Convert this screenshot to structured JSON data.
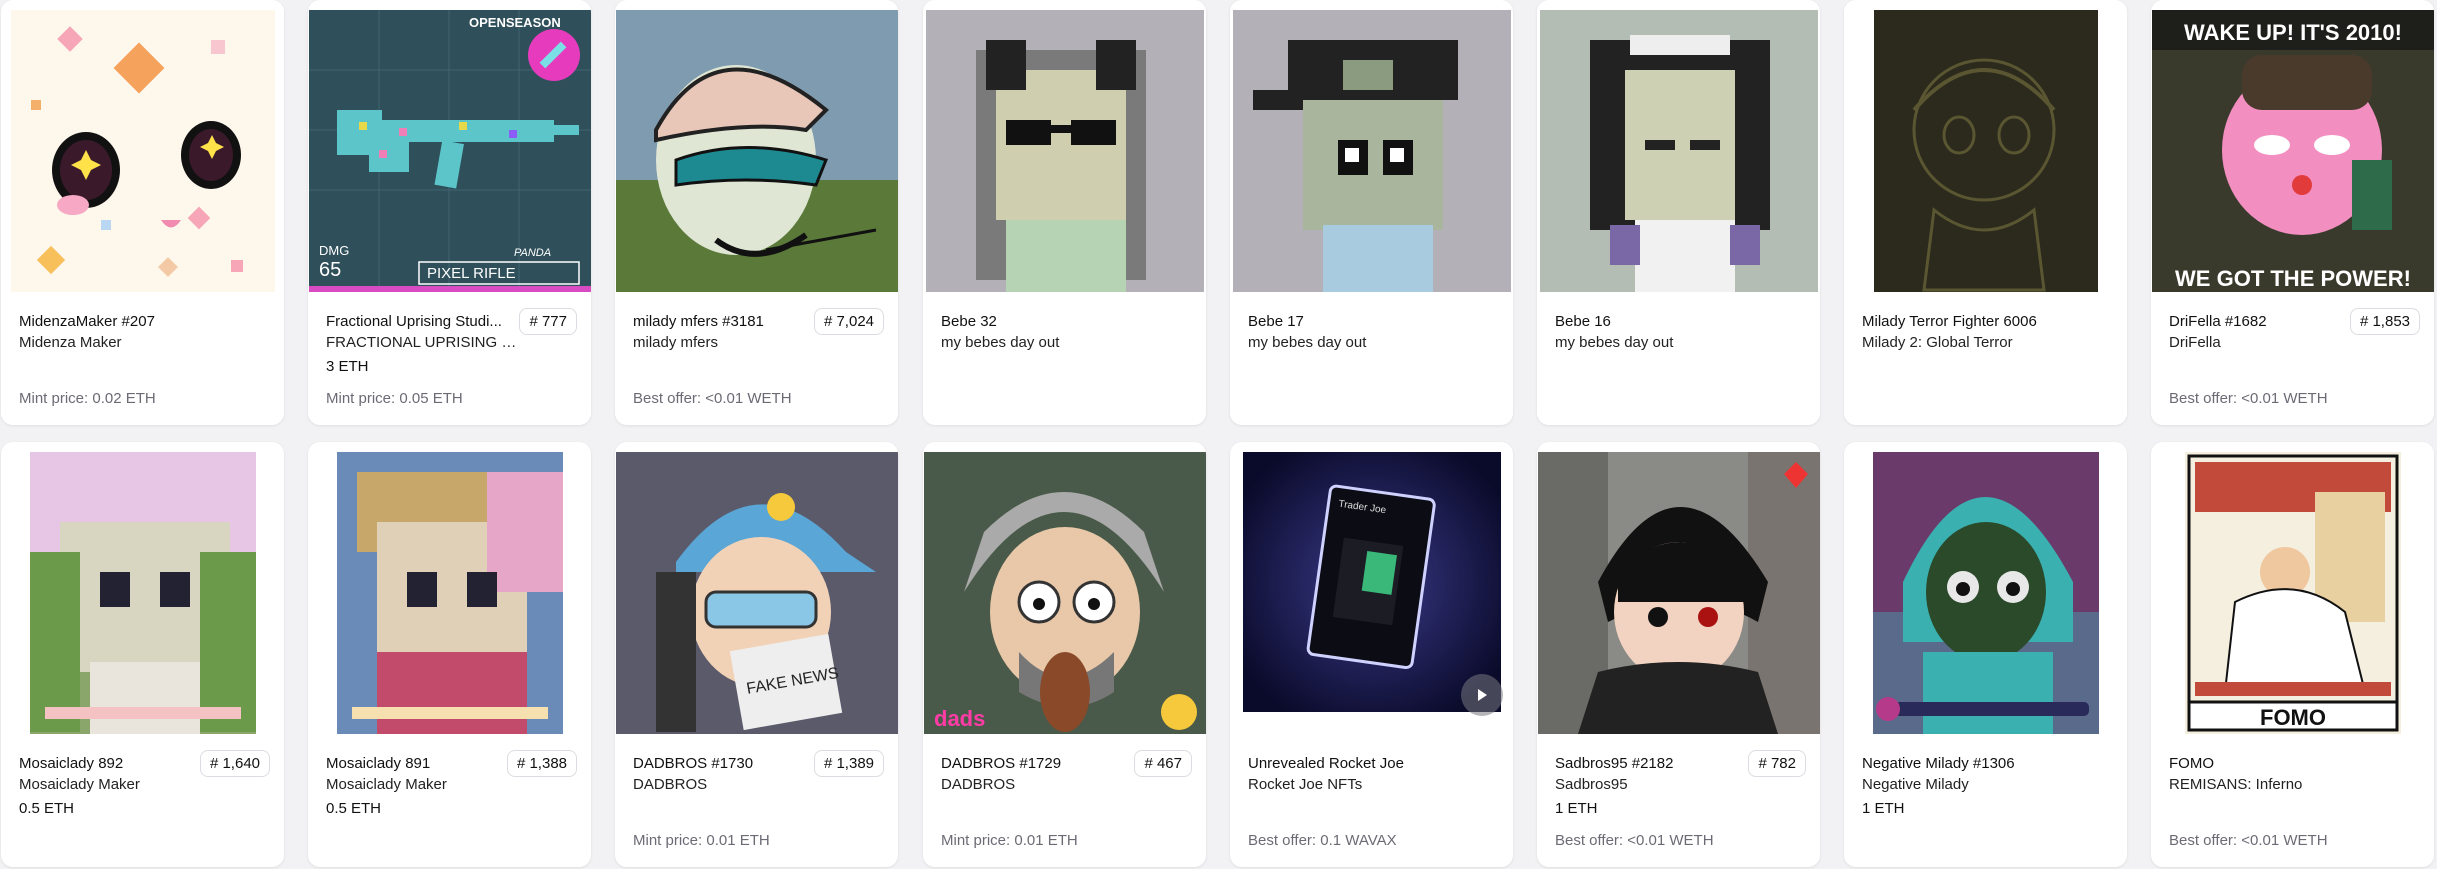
{
  "cards_row1": [
    {
      "name": "MidenzaMaker #207",
      "collection": "Midenza Maker",
      "price": "",
      "rank": "",
      "footer": "Mint price: 0.02 ETH",
      "icon": "midenza-art"
    },
    {
      "name": "Fractional Uprising Studi...",
      "collection": "FRACTIONAL UPRISING ST...",
      "price": "3 ETH",
      "rank": "# 777",
      "footer": "Mint price: 0.05 ETH",
      "icon": "pixel-rifle-art"
    },
    {
      "name": "milady mfers #3181",
      "collection": "milady mfers",
      "price": "",
      "rank": "# 7,024",
      "footer": "Best offer: <0.01 WETH",
      "icon": "milady-mfer-art"
    },
    {
      "name": "Bebe 32",
      "collection": "my bebes day out",
      "price": "",
      "rank": "",
      "footer": "",
      "icon": "bebe-art"
    },
    {
      "name": "Bebe 17",
      "collection": "my bebes day out",
      "price": "",
      "rank": "",
      "footer": "",
      "icon": "bebe-art"
    },
    {
      "name": "Bebe 16",
      "collection": "my bebes day out",
      "price": "",
      "rank": "",
      "footer": "",
      "icon": "bebe-art"
    },
    {
      "name": "Milady Terror Fighter 6006",
      "collection": "Milady 2: Global Terror",
      "price": "",
      "rank": "",
      "footer": "",
      "icon": "terror-fighter-art"
    },
    {
      "name": "DriFella #1682",
      "collection": "DriFella",
      "price": "",
      "rank": "# 1,853",
      "footer": "Best offer: <0.01 WETH",
      "icon": "drifella-art"
    }
  ],
  "cards_row2": [
    {
      "name": "Mosaiclady 892",
      "collection": "Mosaiclady Maker",
      "price": "0.5 ETH",
      "rank": "# 1,640",
      "footer": "",
      "icon": "mosaiclady-art"
    },
    {
      "name": "Mosaiclady 891",
      "collection": "Mosaiclady Maker",
      "price": "0.5 ETH",
      "rank": "# 1,388",
      "footer": "",
      "icon": "mosaiclady-art"
    },
    {
      "name": "DADBROS #1730",
      "collection": "DADBROS",
      "price": "",
      "rank": "# 1,389",
      "footer": "Mint price: 0.01 ETH",
      "icon": "dadbros-art"
    },
    {
      "name": "DADBROS #1729",
      "collection": "DADBROS",
      "price": "",
      "rank": "# 467",
      "footer": "Mint price: 0.01 ETH",
      "icon": "dadbros-art"
    },
    {
      "name": "Unrevealed Rocket Joe",
      "collection": "Rocket Joe NFTs",
      "price": "",
      "rank": "",
      "footer": "Best offer: 0.1 WAVAX",
      "icon": "rocket-joe-card-art"
    },
    {
      "name": "Sadbros95 #2182",
      "collection": "Sadbros95",
      "price": "1 ETH",
      "rank": "# 782",
      "footer": "Best offer: <0.01 WETH",
      "icon": "sadbros-art"
    },
    {
      "name": "Negative Milady #1306",
      "collection": "Negative Milady",
      "price": "1 ETH",
      "rank": "",
      "footer": "",
      "icon": "negative-milady-art"
    },
    {
      "name": "FOMO",
      "collection": "REMISANS: Inferno",
      "price": "",
      "rank": "",
      "footer": "Best offer: <0.01 WETH",
      "icon": "fomo-tarot-art"
    }
  ],
  "art_text": {
    "rifle_brand": "OPENSEASON",
    "rifle_caption": "PIXEL RIFLE",
    "rifle_dmg_label": "DMG",
    "rifle_dmg_value": "65",
    "rifle_panda": "PANDA",
    "drifella_top": "WAKE UP! IT'S 2010!",
    "drifella_bottom": "WE GOT THE POWER!",
    "fomo_caption": "FOMO",
    "dads_logo": "dads",
    "dadbros_paper": "FAKE NEWS",
    "rocket_joe_label": "Trader Joe"
  }
}
